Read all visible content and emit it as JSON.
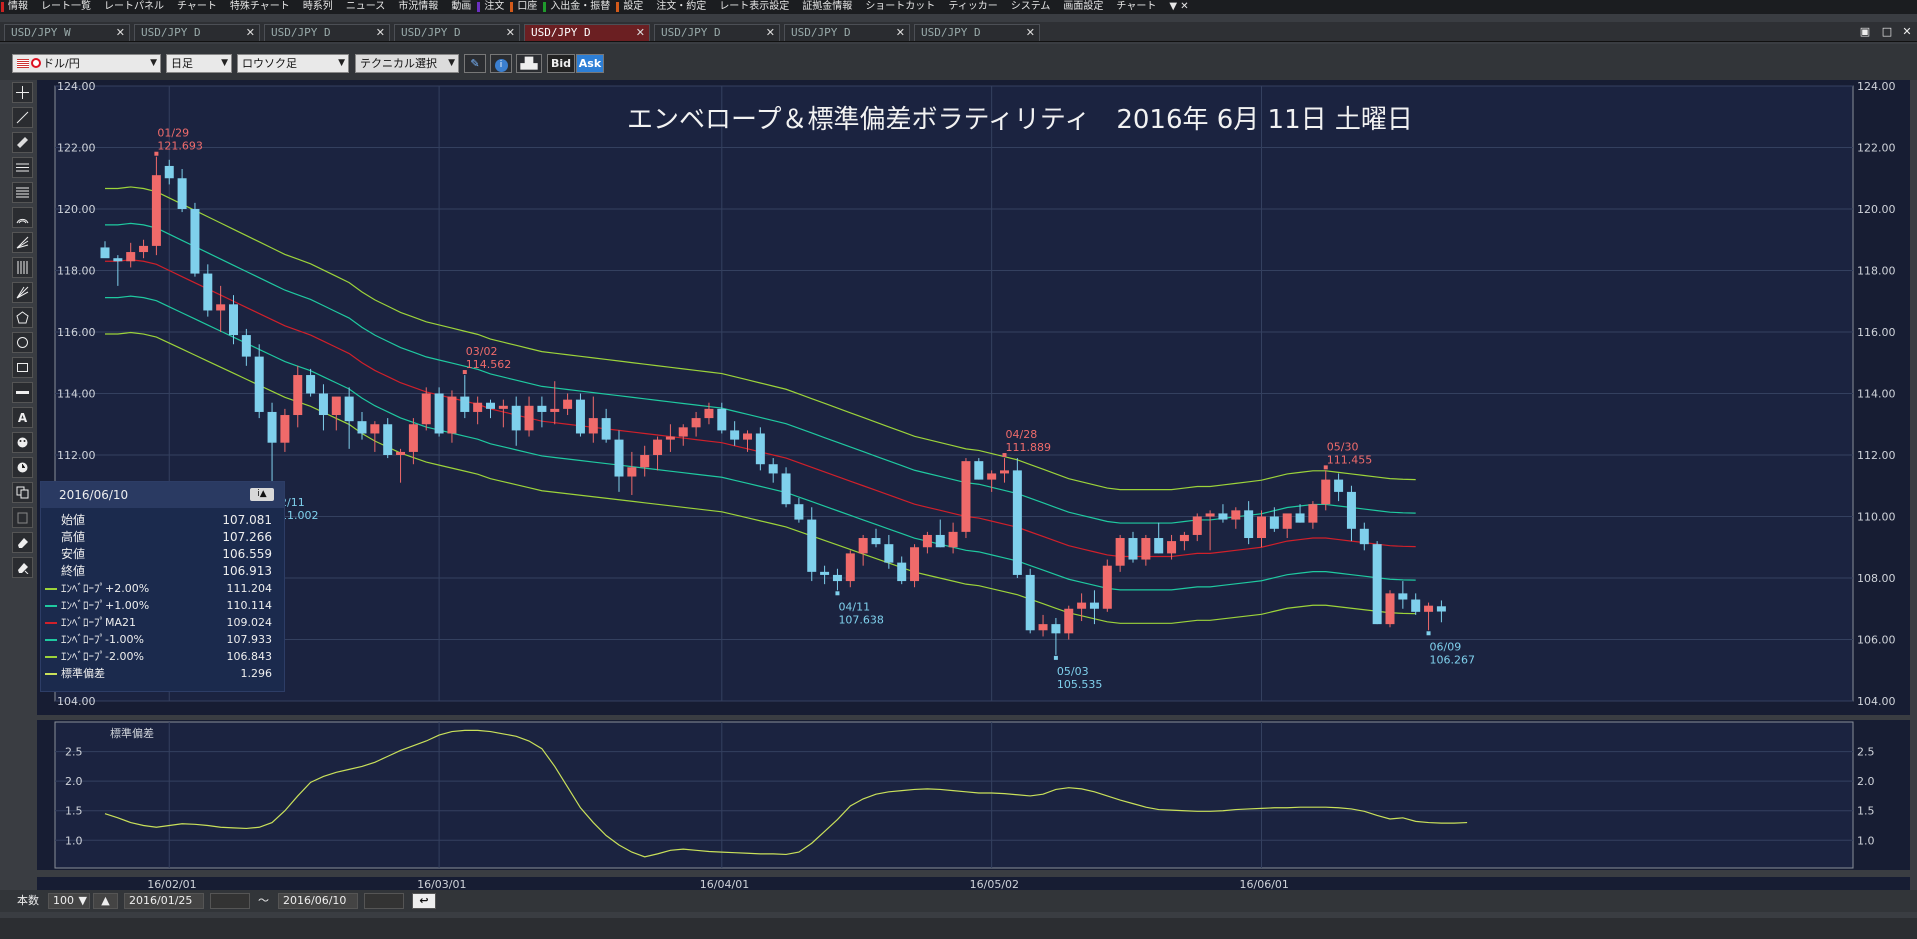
{
  "menu": [
    {
      "label": "情報",
      "mark": "#cc2222"
    },
    {
      "label": "レート一覧",
      "mark": ""
    },
    {
      "label": "レートパネル",
      "mark": ""
    },
    {
      "label": "チャート",
      "mark": ""
    },
    {
      "label": "特殊チャート",
      "mark": ""
    },
    {
      "label": "時系列",
      "mark": ""
    },
    {
      "label": "ニュース",
      "mark": ""
    },
    {
      "label": "市況情報",
      "mark": ""
    },
    {
      "label": "動画",
      "mark": ""
    },
    {
      "label": "注文",
      "mark": "#6a2fbf"
    },
    {
      "label": "口座",
      "mark": "#d25a1a"
    },
    {
      "label": "入出金・振替",
      "mark": "#1f9a2c"
    },
    {
      "label": "設定",
      "mark": "#d25a1a"
    },
    {
      "label": "注文・約定",
      "mark": ""
    },
    {
      "label": "レート表示設定",
      "mark": ""
    },
    {
      "label": "証拠金情報",
      "mark": ""
    },
    {
      "label": "ショートカット",
      "mark": ""
    },
    {
      "label": "ティッカー",
      "mark": ""
    },
    {
      "label": "システム",
      "mark": ""
    },
    {
      "label": "画面設定",
      "mark": ""
    },
    {
      "label": "チャート",
      "mark": ""
    }
  ],
  "menu_extra": "▼ ✕",
  "tabs": [
    {
      "label": "USD/JPY W",
      "active": false
    },
    {
      "label": "USD/JPY D",
      "active": false
    },
    {
      "label": "USD/JPY D",
      "active": false
    },
    {
      "label": "USD/JPY D",
      "active": false
    },
    {
      "label": "USD/JPY D",
      "active": true
    },
    {
      "label": "USD/JPY D",
      "active": false
    },
    {
      "label": "USD/JPY D",
      "active": false
    },
    {
      "label": "USD/JPY D",
      "active": false
    }
  ],
  "tab_close": "✕",
  "toolbar": {
    "pair": "ドル/円",
    "interval": "日足",
    "chart_type": "ロウソク足",
    "technical": "テクニカル選択",
    "bid": "Bid",
    "ask": "Ask"
  },
  "title": "エンベロープ＆標準偏差ボラティリティ　2016年 6月 11日 土曜日",
  "info": {
    "date": "2016/06/10",
    "rows": [
      {
        "label": "始値",
        "value": "107.081",
        "color": ""
      },
      {
        "label": "高値",
        "value": "107.266",
        "color": ""
      },
      {
        "label": "安値",
        "value": "106.559",
        "color": ""
      },
      {
        "label": "終値",
        "value": "106.913",
        "color": ""
      },
      {
        "label": "ｴﾝﾍﾞﾛｰﾌﾟ+2.00%",
        "value": "111.204",
        "color": "#9cd33a"
      },
      {
        "label": "ｴﾝﾍﾞﾛｰﾌﾟ+1.00%",
        "value": "110.114",
        "color": "#1fc9a0"
      },
      {
        "label": "ｴﾝﾍﾞﾛｰﾌﾟMA21",
        "value": "109.024",
        "color": "#d0202a"
      },
      {
        "label": "ｴﾝﾍﾞﾛｰﾌﾟ-1.00%",
        "value": "107.933",
        "color": "#1fc9a0"
      },
      {
        "label": "ｴﾝﾍﾞﾛｰﾌﾟ-2.00%",
        "value": "106.843",
        "color": "#9cd33a"
      },
      {
        "label": "標準偏差",
        "value": "1.296",
        "color": "#c9e05a"
      }
    ]
  },
  "status": {
    "count_label": "本数",
    "count": "100",
    "from": "2016/01/25",
    "tilde": "〜",
    "to": "2016/06/10"
  },
  "chart_data": {
    "type": "candlestick",
    "price_axis": {
      "min": 104,
      "max": 124,
      "ticks": [
        "124.00",
        "122.00",
        "120.00",
        "118.00",
        "116.00",
        "114.00",
        "112.00",
        "110.00",
        "108.00",
        "106.00",
        "104.00"
      ]
    },
    "date_ticks": [
      "16/02/01",
      "16/03/01",
      "16/04/01",
      "16/05/02",
      "16/06/01"
    ],
    "colors": {
      "up": "#f06a6a",
      "down": "#7fd0ec",
      "mid": "#d0202a",
      "inner": "#1fc9a0",
      "outer": "#9cd33a",
      "sd": "#c9e05a"
    },
    "annotations": [
      {
        "date": "01/29",
        "value": "121.693",
        "kind": "high"
      },
      {
        "date": "02/11",
        "value": "111.002",
        "kind": "low"
      },
      {
        "date": "03/02",
        "value": "114.562",
        "kind": "high"
      },
      {
        "date": "04/11",
        "value": "107.638",
        "kind": "low"
      },
      {
        "date": "04/28",
        "value": "111.889",
        "kind": "high"
      },
      {
        "date": "05/03",
        "value": "105.535",
        "kind": "low"
      },
      {
        "date": "05/30",
        "value": "111.455",
        "kind": "high"
      },
      {
        "date": "06/09",
        "value": "106.267",
        "kind": "low"
      }
    ],
    "candles": [
      [
        118.75,
        118.95,
        118.5,
        118.4
      ],
      [
        118.4,
        118.5,
        117.5,
        118.3
      ],
      [
        118.3,
        118.9,
        118.1,
        118.6
      ],
      [
        118.6,
        119.0,
        118.4,
        118.8
      ],
      [
        118.8,
        121.7,
        118.5,
        121.1
      ],
      [
        121.4,
        121.6,
        120.8,
        121.0
      ],
      [
        121.0,
        121.3,
        119.9,
        120.0
      ],
      [
        120.0,
        120.2,
        117.8,
        117.9
      ],
      [
        117.9,
        118.2,
        116.5,
        116.7
      ],
      [
        116.7,
        117.5,
        116.0,
        116.9
      ],
      [
        116.9,
        117.2,
        115.6,
        115.9
      ],
      [
        115.9,
        116.1,
        114.9,
        115.2
      ],
      [
        115.2,
        115.6,
        113.2,
        113.4
      ],
      [
        113.4,
        113.7,
        111.0,
        112.4
      ],
      [
        112.4,
        113.5,
        112.1,
        113.3
      ],
      [
        113.3,
        114.9,
        112.9,
        114.6
      ],
      [
        114.6,
        114.8,
        113.9,
        114.0
      ],
      [
        114.0,
        114.3,
        112.8,
        113.3
      ],
      [
        113.3,
        113.8,
        112.8,
        113.9
      ],
      [
        113.9,
        114.2,
        112.2,
        113.1
      ],
      [
        113.1,
        113.4,
        112.5,
        112.7
      ],
      [
        112.7,
        113.1,
        112.1,
        113.0
      ],
      [
        113.0,
        113.2,
        111.9,
        112.0
      ],
      [
        112.0,
        112.2,
        111.1,
        112.1
      ],
      [
        112.1,
        113.2,
        111.7,
        113.0
      ],
      [
        113.0,
        114.2,
        112.8,
        114.0
      ],
      [
        114.0,
        114.2,
        112.6,
        112.7
      ],
      [
        112.7,
        114.1,
        112.4,
        113.9
      ],
      [
        113.9,
        114.6,
        113.2,
        113.4
      ],
      [
        113.4,
        113.9,
        113.0,
        113.7
      ],
      [
        113.7,
        113.8,
        113.2,
        113.5
      ],
      [
        113.5,
        113.8,
        112.9,
        113.6
      ],
      [
        113.6,
        113.9,
        112.3,
        112.8
      ],
      [
        112.8,
        113.9,
        112.6,
        113.6
      ],
      [
        113.6,
        113.9,
        112.9,
        113.4
      ],
      [
        113.4,
        114.4,
        113.0,
        113.5
      ],
      [
        113.5,
        114.0,
        113.3,
        113.8
      ],
      [
        113.8,
        114.0,
        112.6,
        112.7
      ],
      [
        112.7,
        113.9,
        112.4,
        113.2
      ],
      [
        113.2,
        113.5,
        112.4,
        112.5
      ],
      [
        112.5,
        112.8,
        110.8,
        111.3
      ],
      [
        111.3,
        112.1,
        110.7,
        111.6
      ],
      [
        111.6,
        112.3,
        111.3,
        112.0
      ],
      [
        112.0,
        112.6,
        111.5,
        112.5
      ],
      [
        112.5,
        113.0,
        112.1,
        112.6
      ],
      [
        112.6,
        113.0,
        112.3,
        112.9
      ],
      [
        112.9,
        113.4,
        112.6,
        113.2
      ],
      [
        113.2,
        113.7,
        113.0,
        113.5
      ],
      [
        113.5,
        113.7,
        112.7,
        112.8
      ],
      [
        112.8,
        113.1,
        112.3,
        112.5
      ],
      [
        112.5,
        112.8,
        112.1,
        112.7
      ],
      [
        112.7,
        112.9,
        111.5,
        111.7
      ],
      [
        111.7,
        111.9,
        111.1,
        111.4
      ],
      [
        111.4,
        111.6,
        110.3,
        110.4
      ],
      [
        110.4,
        110.6,
        109.8,
        109.9
      ],
      [
        109.9,
        110.3,
        107.9,
        108.2
      ],
      [
        108.2,
        108.4,
        107.8,
        108.1
      ],
      [
        108.1,
        108.3,
        107.6,
        107.9
      ],
      [
        107.9,
        108.9,
        107.7,
        108.8
      ],
      [
        108.8,
        109.4,
        108.4,
        109.3
      ],
      [
        109.3,
        109.6,
        109.0,
        109.1
      ],
      [
        109.1,
        109.4,
        108.3,
        108.5
      ],
      [
        108.5,
        108.7,
        107.8,
        107.9
      ],
      [
        107.9,
        109.1,
        107.7,
        109.0
      ],
      [
        109.0,
        109.5,
        108.8,
        109.4
      ],
      [
        109.4,
        109.9,
        109.0,
        109.0
      ],
      [
        109.0,
        109.8,
        108.8,
        109.5
      ],
      [
        109.5,
        111.9,
        109.3,
        111.8
      ],
      [
        111.8,
        111.9,
        111.2,
        111.2
      ],
      [
        111.2,
        111.5,
        110.8,
        111.4
      ],
      [
        111.4,
        111.9,
        111.1,
        111.5
      ],
      [
        111.5,
        111.9,
        108.0,
        108.1
      ],
      [
        108.1,
        108.3,
        106.2,
        106.3
      ],
      [
        106.3,
        106.8,
        106.1,
        106.5
      ],
      [
        106.5,
        106.7,
        105.5,
        106.2
      ],
      [
        106.2,
        107.1,
        106.0,
        107.0
      ],
      [
        107.0,
        107.5,
        106.6,
        107.2
      ],
      [
        107.2,
        107.6,
        106.5,
        107.0
      ],
      [
        107.0,
        108.6,
        106.9,
        108.4
      ],
      [
        108.4,
        109.4,
        108.2,
        109.3
      ],
      [
        109.3,
        109.5,
        108.5,
        108.6
      ],
      [
        108.6,
        109.4,
        108.4,
        109.3
      ],
      [
        109.3,
        109.8,
        108.8,
        108.8
      ],
      [
        108.8,
        109.4,
        108.6,
        109.2
      ],
      [
        109.2,
        109.5,
        108.9,
        109.4
      ],
      [
        109.4,
        110.1,
        109.2,
        110.0
      ],
      [
        110.0,
        110.2,
        108.9,
        110.1
      ],
      [
        110.1,
        110.4,
        109.8,
        109.9
      ],
      [
        109.9,
        110.3,
        109.6,
        110.2
      ],
      [
        110.2,
        110.5,
        109.1,
        109.3
      ],
      [
        109.3,
        110.2,
        109.0,
        110.0
      ],
      [
        110.0,
        110.3,
        109.5,
        109.6
      ],
      [
        109.6,
        110.0,
        109.3,
        110.1
      ],
      [
        110.1,
        110.4,
        109.8,
        109.8
      ],
      [
        109.8,
        110.5,
        109.6,
        110.4
      ],
      [
        110.4,
        111.5,
        110.2,
        111.2
      ],
      [
        111.2,
        111.4,
        110.5,
        110.8
      ],
      [
        110.8,
        111.0,
        109.2,
        109.6
      ],
      [
        109.6,
        109.8,
        108.9,
        109.1
      ],
      [
        109.1,
        109.2,
        106.5,
        106.5
      ],
      [
        106.5,
        107.6,
        106.4,
        107.5
      ],
      [
        107.5,
        107.9,
        107.0,
        107.3
      ],
      [
        107.3,
        107.5,
        106.8,
        106.9
      ],
      [
        106.9,
        107.2,
        106.3,
        107.1
      ],
      [
        107.08,
        107.27,
        106.56,
        106.91
      ]
    ],
    "ma21": [
      118.3,
      118.3,
      118.35,
      118.3,
      118.2,
      118.0,
      117.8,
      117.6,
      117.4,
      117.2,
      117.0,
      116.8,
      116.6,
      116.4,
      116.2,
      116.05,
      115.9,
      115.7,
      115.5,
      115.3,
      115.0,
      114.75,
      114.55,
      114.35,
      114.2,
      114.05,
      113.95,
      113.85,
      113.75,
      113.65,
      113.5,
      113.4,
      113.3,
      113.2,
      113.1,
      113.05,
      113.0,
      112.95,
      112.9,
      112.85,
      112.8,
      112.75,
      112.7,
      112.65,
      112.6,
      112.55,
      112.5,
      112.45,
      112.4,
      112.3,
      112.2,
      112.1,
      112.0,
      111.9,
      111.75,
      111.6,
      111.45,
      111.3,
      111.15,
      111.0,
      110.85,
      110.7,
      110.55,
      110.4,
      110.3,
      110.2,
      110.1,
      110.0,
      109.95,
      109.85,
      109.75,
      109.65,
      109.5,
      109.35,
      109.2,
      109.05,
      108.95,
      108.85,
      108.75,
      108.7,
      108.7,
      108.7,
      108.7,
      108.7,
      108.75,
      108.8,
      108.8,
      108.85,
      108.9,
      108.95,
      109.0,
      109.1,
      109.2,
      109.25,
      109.3,
      109.3,
      109.25,
      109.2,
      109.15,
      109.1,
      109.05,
      109.03,
      109.02
    ],
    "sd": [
      1.45,
      1.38,
      1.3,
      1.25,
      1.22,
      1.25,
      1.28,
      1.27,
      1.25,
      1.22,
      1.21,
      1.2,
      1.22,
      1.3,
      1.5,
      1.75,
      1.98,
      2.08,
      2.15,
      2.2,
      2.25,
      2.32,
      2.42,
      2.52,
      2.6,
      2.68,
      2.78,
      2.84,
      2.86,
      2.86,
      2.84,
      2.8,
      2.76,
      2.68,
      2.55,
      2.25,
      1.9,
      1.55,
      1.3,
      1.08,
      0.92,
      0.8,
      0.72,
      0.77,
      0.83,
      0.85,
      0.83,
      0.81,
      0.8,
      0.79,
      0.78,
      0.77,
      0.77,
      0.76,
      0.8,
      0.95,
      1.15,
      1.35,
      1.58,
      1.7,
      1.78,
      1.82,
      1.84,
      1.86,
      1.87,
      1.86,
      1.84,
      1.82,
      1.8,
      1.8,
      1.79,
      1.77,
      1.75,
      1.78,
      1.86,
      1.89,
      1.87,
      1.82,
      1.75,
      1.68,
      1.62,
      1.56,
      1.52,
      1.51,
      1.5,
      1.49,
      1.49,
      1.5,
      1.52,
      1.53,
      1.54,
      1.55,
      1.55,
      1.56,
      1.56,
      1.56,
      1.55,
      1.53,
      1.49,
      1.42,
      1.36,
      1.38,
      1.32,
      1.3,
      1.29,
      1.29,
      1.3
    ],
    "sd_axis": {
      "label": "標準偏差",
      "min": 0.7,
      "max": 2.9,
      "ticks": [
        "2.5",
        "2.0",
        "1.5",
        "1.0"
      ]
    }
  }
}
